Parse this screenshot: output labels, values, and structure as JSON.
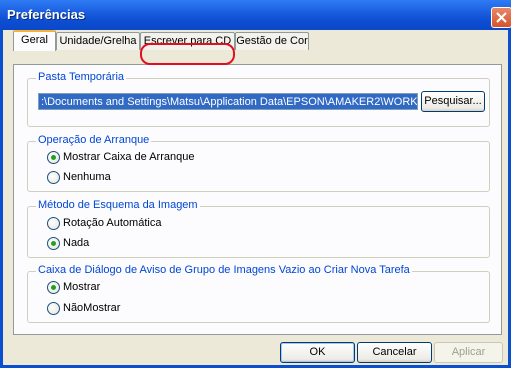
{
  "window": {
    "title": "Preferências"
  },
  "tabs": [
    {
      "label": "Geral",
      "active": true
    },
    {
      "label": "Unidade/Grelha",
      "active": false
    },
    {
      "label": "Escrever para CD",
      "active": false
    },
    {
      "label": "Gestão de Cor",
      "active": false
    }
  ],
  "temp_folder": {
    "label": "Pasta Temporária",
    "path": ":\\Documents and Settings\\Matsu\\Application Data\\EPSON\\AMAKER2\\WORK",
    "browse_label": "Pesquisar..."
  },
  "startup": {
    "label": "Operação de Arranque",
    "options": [
      {
        "label": "Mostrar Caixa de Arranque",
        "selected": true
      },
      {
        "label": "Nenhuma",
        "selected": false
      }
    ]
  },
  "image_layout": {
    "label": "Método de Esquema da Imagem",
    "options": [
      {
        "label": "Rotação Automática",
        "selected": false
      },
      {
        "label": "Nada",
        "selected": true
      }
    ]
  },
  "empty_group_warning": {
    "label": "Caixa de Diálogo de Aviso de Grupo de Imagens Vazio ao Criar Nova Tarefa",
    "options": [
      {
        "label": "Mostrar",
        "selected": true
      },
      {
        "label": "NãoMostrar",
        "selected": false
      }
    ]
  },
  "buttons": {
    "ok": "OK",
    "cancel": "Cancelar",
    "apply": "Aplicar"
  },
  "colors": {
    "titlebar": "#0a4fd0",
    "accent_text": "#0046d5",
    "highlight_ring": "#e01020",
    "radio_dot": "#21a121"
  }
}
